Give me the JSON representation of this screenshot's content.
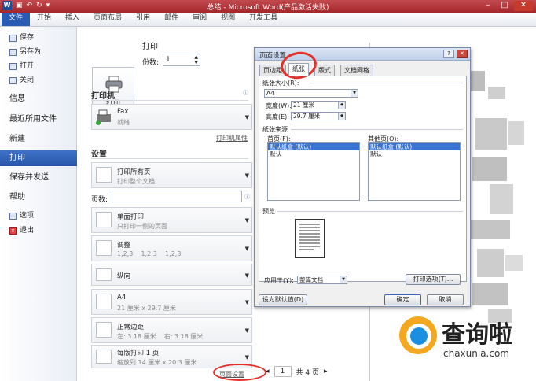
{
  "window": {
    "title": "总结 - Microsoft Word(产品激活失败)"
  },
  "ribbon": {
    "tabs": [
      "文件",
      "开始",
      "插入",
      "页面布局",
      "引用",
      "邮件",
      "审阅",
      "视图",
      "开发工具"
    ]
  },
  "nav": {
    "save": "保存",
    "saveas": "另存为",
    "open": "打开",
    "close": "关闭",
    "info": "信息",
    "recent": "最近所用文件",
    "new": "新建",
    "print": "打印",
    "share": "保存并发送",
    "help": "帮助",
    "options": "选项",
    "exit": "退出"
  },
  "print": {
    "heading": "打印",
    "button": "打印",
    "copies_label": "份数:",
    "copies_value": "1",
    "printer_heading": "打印机",
    "printer_name": "Fax",
    "printer_status": "就绪",
    "printer_props": "打印机属性",
    "settings_heading": "设置",
    "range_main": "打印所有页",
    "range_sub": "打印整个文档",
    "pages_label": "页数:",
    "side_main": "单面打印",
    "side_sub": "只打印一侧的页面",
    "collate_main": "调整",
    "collate_sub": "1,2,3    1,2,3    1,2,3",
    "orient_main": "纵向",
    "paper_main": "A4",
    "paper_sub": "21 厘米 x 29.7 厘米",
    "margin_main": "正常边距",
    "margin_sub": "左: 3.18 厘米    右: 3.18 厘米",
    "perpage_main": "每版打印 1 页",
    "perpage_sub": "缩放到 14 厘米 x 20.3 厘米",
    "page_setup_link": "页面设置"
  },
  "pager": {
    "current": "1",
    "total": "共 4 页"
  },
  "dialog": {
    "title": "页面设置",
    "tabs": [
      "页边距",
      "纸张",
      "版式",
      "文档网格"
    ],
    "paper_size_group": "纸张大小(R):",
    "paper_size_value": "A4",
    "width_label": "宽度(W):",
    "width_value": "21 厘米",
    "height_label": "高度(E):",
    "height_value": "29.7 厘米",
    "source_group": "纸张来源",
    "first_page_label": "首页(F):",
    "other_pages_label": "其他页(O):",
    "tray_selected": "默认纸盒 (默认)",
    "tray_item": "默认",
    "preview_group": "预览",
    "apply_label": "应用于(Y):",
    "apply_value": "整篇文档",
    "print_options": "打印选项(T)...",
    "default_button": "设为默认值(D)",
    "ok": "确定",
    "cancel": "取消"
  },
  "watermark": {
    "brand": "查询啦",
    "site": "chaxunla.com"
  },
  "colors": {
    "accent": "#2a5bb2",
    "title_bar": "#b3363a",
    "annotation": "#e3302a",
    "logo_orange": "#f3a81f",
    "logo_blue": "#1a8ee1"
  }
}
